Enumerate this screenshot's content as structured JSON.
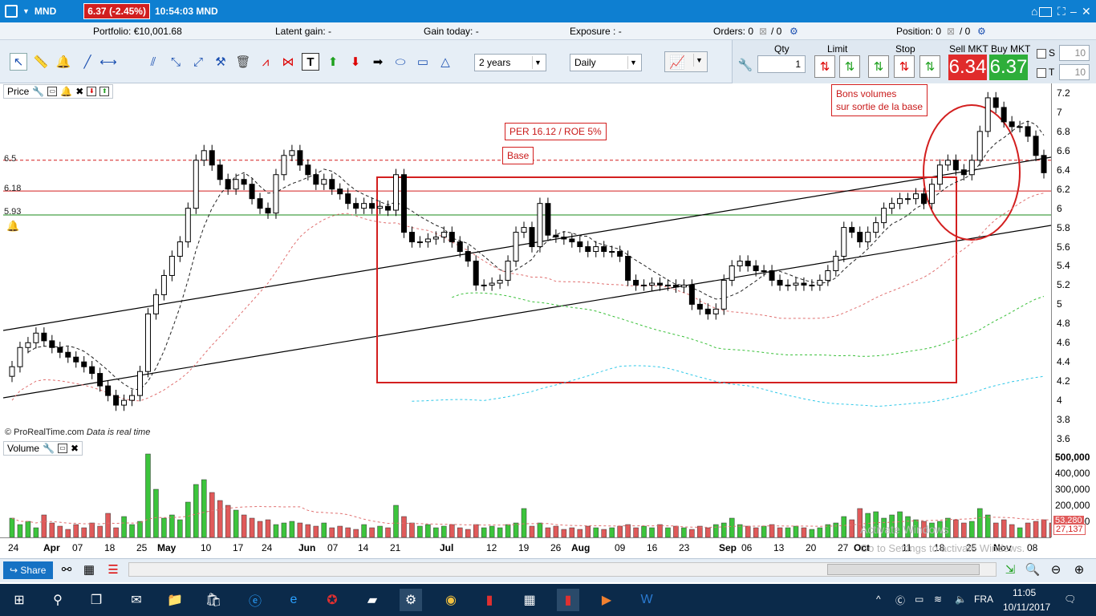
{
  "titlebar": {
    "ticker": "MND",
    "price_change": "6.37 (-2.45%)",
    "clock": "10:54:03 MND"
  },
  "status": {
    "portfolio": "Portfolio: €10,001.68",
    "latent_gain": "Latent gain: -",
    "gain_today": "Gain today: -",
    "exposure": "Exposure : -",
    "orders": "Orders: 0",
    "orders_total": "/ 0",
    "position": "Position: 0",
    "position_total": "/ 0"
  },
  "toolbar": {
    "period": "2 years",
    "interval": "Daily"
  },
  "order_panel": {
    "qty_label": "Qty",
    "qty_value": "1",
    "limit_label": "Limit",
    "stop_label": "Stop",
    "sell_label": "Sell MKT",
    "buy_label": "Buy MKT",
    "sell_price": "6.34",
    "buy_price": "6.37",
    "s_label": "S",
    "t_label": "T",
    "s_value": "10",
    "t_value": "10"
  },
  "price_panel": {
    "title": "Price"
  },
  "volume_panel": {
    "title": "Volume"
  },
  "annotations": {
    "per": "PER 16.12 / ROE 5%",
    "base": "Base",
    "volumes_line1": "Bons volumes",
    "volumes_line2": "sur sortie de la base"
  },
  "levels": {
    "l1": "6.5",
    "l2": "6.18",
    "l3": "5.93"
  },
  "credit": "© ProRealTime.com",
  "credit_note": "Data is real time",
  "price_axis": [
    "7.2",
    "7",
    "6.8",
    "6.6",
    "6.4",
    "6.2",
    "6",
    "5.8",
    "5.6",
    "5.4",
    "5.2",
    "5",
    "4.8",
    "4.6",
    "4.4",
    "4.2",
    "4",
    "3.8",
    "3.6"
  ],
  "volume_axis": [
    "500,000",
    "400,000",
    "300,000",
    "200,000",
    "100,000"
  ],
  "volume_tags": {
    "v1": "53,280",
    "v2": "27,137"
  },
  "dates": [
    "24",
    "Apr",
    "07",
    "18",
    "25",
    "May",
    "10",
    "17",
    "24",
    "Jun",
    "07",
    "14",
    "21",
    "Jul",
    "12",
    "19",
    "26",
    "Aug",
    "09",
    "16",
    "23",
    "Sep",
    "06",
    "13",
    "20",
    "27",
    "Oct",
    "11",
    "18",
    "25",
    "Nov",
    "08"
  ],
  "watermark": {
    "line1": "Activate Windows",
    "line2": "Go to Settings to activate Windows."
  },
  "bottom": {
    "share": "Share"
  },
  "taskbar": {
    "lang": "FRA",
    "time": "11:05",
    "date": "10/11/2017"
  },
  "chart_data": {
    "type": "candlestick",
    "ylim": [
      3.6,
      7.3
    ],
    "levels": [
      6.5,
      6.18,
      5.93
    ],
    "closes": [
      4.35,
      4.55,
      4.6,
      4.7,
      4.62,
      4.55,
      4.5,
      4.45,
      4.4,
      4.35,
      4.28,
      4.15,
      4.05,
      3.95,
      4.0,
      4.05,
      4.3,
      4.9,
      5.1,
      5.3,
      5.5,
      5.65,
      6.0,
      6.5,
      6.6,
      6.45,
      6.3,
      6.2,
      6.3,
      6.25,
      6.1,
      6.0,
      5.95,
      6.35,
      6.55,
      6.6,
      6.45,
      6.35,
      6.25,
      6.3,
      6.2,
      6.15,
      6.05,
      6.0,
      6.05,
      6.0,
      6.02,
      5.98,
      6.35,
      5.75,
      5.65,
      5.65,
      5.68,
      5.7,
      5.75,
      5.65,
      5.55,
      5.45,
      5.2,
      5.2,
      5.22,
      5.25,
      5.45,
      5.75,
      5.8,
      5.6,
      6.05,
      5.72,
      5.7,
      5.68,
      5.65,
      5.6,
      5.55,
      5.6,
      5.55,
      5.55,
      5.5,
      5.25,
      5.2,
      5.2,
      5.22,
      5.2,
      5.2,
      5.18,
      5.2,
      5.0,
      4.95,
      4.9,
      4.95,
      5.25,
      5.4,
      5.45,
      5.4,
      5.35,
      5.35,
      5.25,
      5.2,
      5.2,
      5.22,
      5.2,
      5.2,
      5.25,
      5.35,
      5.5,
      5.8,
      5.75,
      5.65,
      5.75,
      5.85,
      6.0,
      6.05,
      6.1,
      6.1,
      6.15,
      6.05,
      6.25,
      6.45,
      6.5,
      6.4,
      6.35,
      6.5,
      6.8,
      7.15,
      7.05,
      6.9,
      6.85,
      6.85,
      6.75,
      6.55,
      6.37
    ],
    "volumes": [
      120,
      80,
      100,
      60,
      140,
      90,
      70,
      50,
      80,
      60,
      90,
      70,
      150,
      60,
      130,
      80,
      100,
      520,
      300,
      120,
      140,
      110,
      220,
      330,
      360,
      280,
      230,
      200,
      170,
      140,
      120,
      100,
      110,
      80,
      90,
      100,
      90,
      80,
      70,
      90,
      60,
      70,
      60,
      50,
      80,
      60,
      70,
      60,
      200,
      130,
      90,
      70,
      80,
      60,
      70,
      80,
      60,
      50,
      80,
      60,
      70,
      60,
      80,
      90,
      180,
      70,
      90,
      60,
      70,
      50,
      60,
      50,
      70,
      60,
      50,
      60,
      70,
      80,
      60,
      70,
      60,
      80,
      60,
      70,
      60,
      50,
      70,
      60,
      80,
      90,
      120,
      80,
      70,
      60,
      70,
      80,
      60,
      60,
      70,
      60,
      50,
      60,
      80,
      90,
      130,
      110,
      180,
      150,
      160,
      120,
      140,
      160,
      130,
      110,
      100,
      90,
      100,
      120,
      110,
      90,
      100,
      180,
      140,
      90,
      110,
      80,
      60,
      90,
      100,
      110,
      90
    ]
  }
}
